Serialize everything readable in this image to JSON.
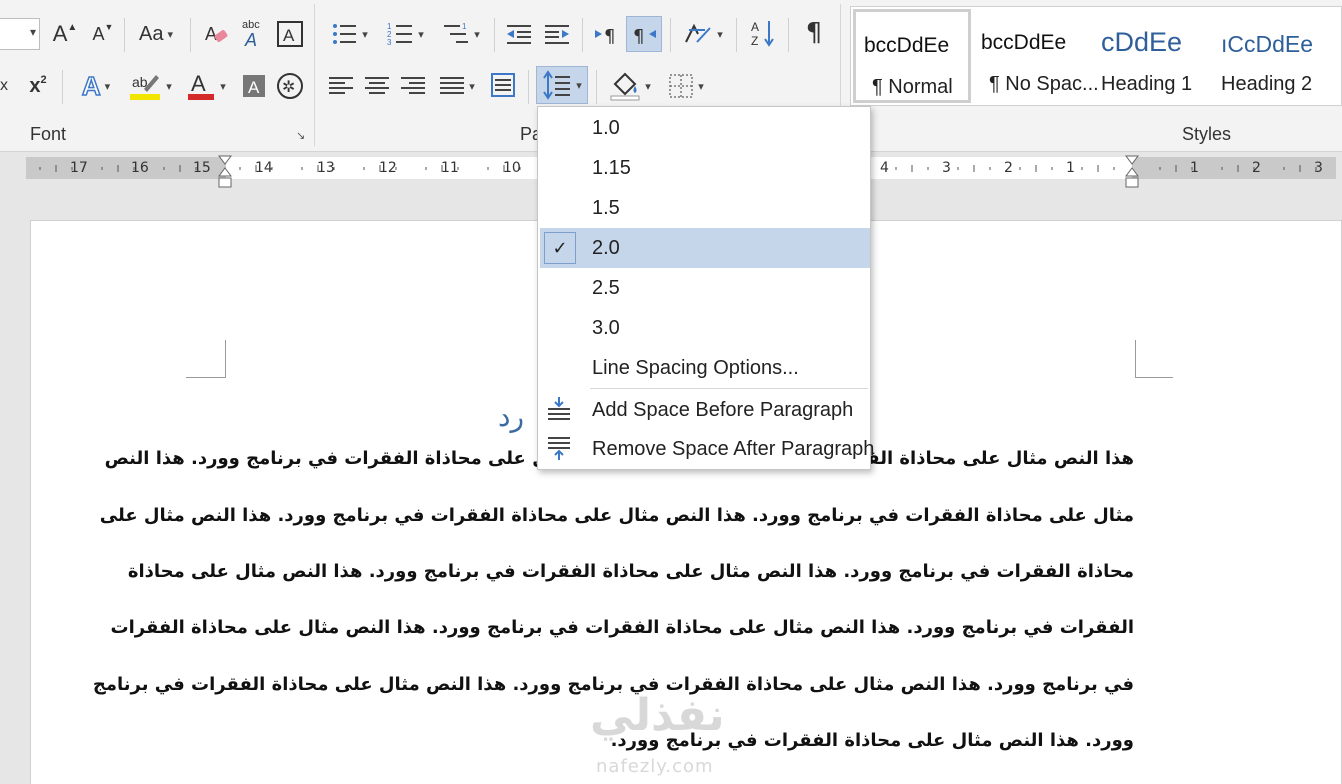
{
  "ribbon": {
    "groups": {
      "font": "Font",
      "paragraph": "Pa",
      "styles": "Styles"
    },
    "launcher_glyph": "↘",
    "font_size_value": "",
    "buttons": {
      "grow_font": "A",
      "shrink_font": "A",
      "change_case": "Aa",
      "clear_format": "A",
      "phonetic": "abc",
      "char_border": "A",
      "subscript": "x",
      "superscript": "x",
      "text_effects": "A",
      "highlight": "ab",
      "font_color": "A",
      "char_shading": "A",
      "enclose": "字",
      "sort": "A",
      "show_marks": "¶"
    },
    "styles": [
      {
        "sample": "bccDdEe",
        "name": "¶ Normal"
      },
      {
        "sample": "bccDdEe",
        "name": "¶ No Spac..."
      },
      {
        "sample": "cDdEe",
        "name": "Heading 1"
      },
      {
        "sample": "ıCcDdEe",
        "name": "Heading 2"
      }
    ],
    "colors": {
      "accent_blue": "#2e5f9a",
      "selected_fill": "#c5d5ea",
      "font_color_red": "#d42a2a",
      "highlight_yellow": "#f2e600"
    }
  },
  "ruler": {
    "left_numbers": [
      "17",
      "16",
      "15",
      "14",
      "13",
      "12",
      "11",
      "10"
    ],
    "right_numbers": [
      "4",
      "3",
      "2",
      "1",
      "1",
      "2",
      "3"
    ]
  },
  "line_spacing_menu": {
    "options": [
      "1.0",
      "1.15",
      "1.5",
      "2.0",
      "2.5",
      "3.0"
    ],
    "selected": "2.0",
    "check_glyph": "✓",
    "options_link": "Line Spacing Options...",
    "add_space_before": "Add Space Before Paragraph",
    "remove_space_after": "Remove Space After Paragraph"
  },
  "document": {
    "title_fragment": "رد",
    "lines": [
      "هذا النص مثال على محاذاة الفقرات في برنامج وورد. هذا النص مثال على محاذاة الفقرات في برنامج وورد. هذا النص",
      "مثال على محاذاة الفقرات في برنامج وورد. هذا النص مثال على محاذاة الفقرات في برنامج وورد. هذا النص مثال على",
      "محاذاة الفقرات في برنامج وورد. هذا النص مثال على محاذاة الفقرات في برنامج وورد. هذا النص مثال على محاذاة",
      "الفقرات في برنامج وورد. هذا النص مثال على محاذاة الفقرات في برنامج وورد. هذا النص مثال على محاذاة الفقرات",
      "في برنامج وورد. هذا النص مثال على محاذاة الفقرات في برنامج وورد. هذا النص مثال على محاذاة الفقرات في برنامج",
      "وورد. هذا النص مثال على محاذاة الفقرات في برنامج وورد."
    ]
  },
  "watermark": {
    "arabic": "نفذلي",
    "latin": "nafezly.com"
  }
}
